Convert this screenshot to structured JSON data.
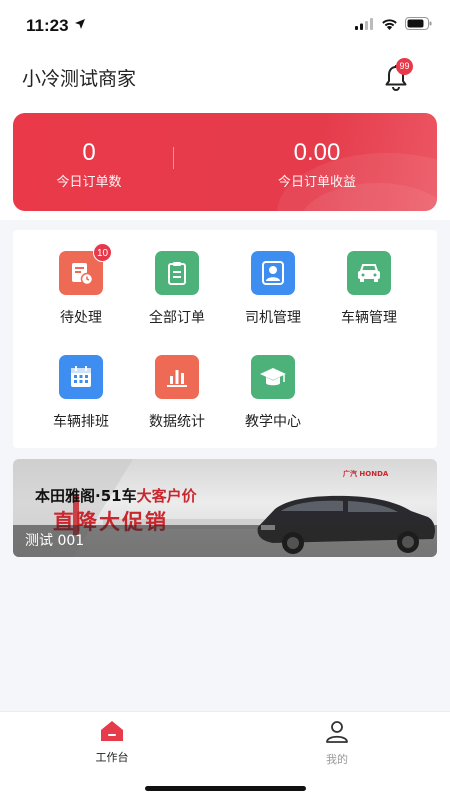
{
  "status_bar": {
    "time": "11:23"
  },
  "header": {
    "merchant_name": "小冷测试商家",
    "notification_badge": "99"
  },
  "stats": [
    {
      "value": "0",
      "label": "今日订单数"
    },
    {
      "value": "0.00",
      "label": "今日订单收益"
    }
  ],
  "menu": {
    "items": [
      {
        "label": "待处理",
        "icon": "pending-orders-icon",
        "color": "#ee6a55",
        "badge": "10"
      },
      {
        "label": "全部订单",
        "icon": "clipboard-icon",
        "color": "#4db27a"
      },
      {
        "label": "司机管理",
        "icon": "driver-icon",
        "color": "#3d8ef0"
      },
      {
        "label": "车辆管理",
        "icon": "car-icon",
        "color": "#4db27a"
      },
      {
        "label": "车辆排班",
        "icon": "calendar-icon",
        "color": "#3d8ef0"
      },
      {
        "label": "数据统计",
        "icon": "bar-chart-icon",
        "color": "#ee6a55"
      },
      {
        "label": "教学中心",
        "icon": "graduation-cap-icon",
        "color": "#4db27a"
      }
    ]
  },
  "banner": {
    "caption": "测试 001",
    "headline": "本田雅阁·51车",
    "highlight": "大客户价",
    "promo": "直降大促销",
    "brand": "广汽 HONDA"
  },
  "tabbar": {
    "tabs": [
      {
        "label": "工作台",
        "active": true
      },
      {
        "label": "我的",
        "active": false
      }
    ]
  },
  "colors": {
    "accent": "#e53b4b",
    "background": "#f5f6fa",
    "inactive_tab": "#999999"
  }
}
